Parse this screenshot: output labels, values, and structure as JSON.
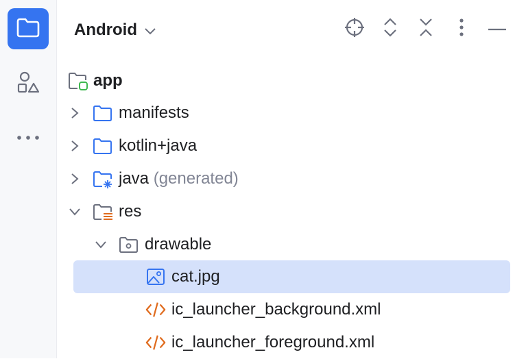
{
  "toolbar": {
    "title": "Android"
  },
  "rail": {
    "items": [
      "project",
      "resource-manager",
      "more"
    ]
  },
  "tree": {
    "root": {
      "label": "app"
    },
    "items": [
      {
        "label": "manifests",
        "suffix": ""
      },
      {
        "label": "kotlin+java",
        "suffix": ""
      },
      {
        "label": "java",
        "suffix": "(generated)"
      },
      {
        "label": "res",
        "suffix": ""
      },
      {
        "label": "drawable",
        "suffix": ""
      },
      {
        "label": "cat.jpg",
        "suffix": ""
      },
      {
        "label": "ic_launcher_background.xml",
        "suffix": ""
      },
      {
        "label": "ic_launcher_foreground.xml",
        "suffix": ""
      }
    ]
  },
  "colors": {
    "accent": "#3574f0",
    "selection": "#d5e1fb",
    "xml_icon": "#e06c1f",
    "module_badge": "#3fb950"
  }
}
